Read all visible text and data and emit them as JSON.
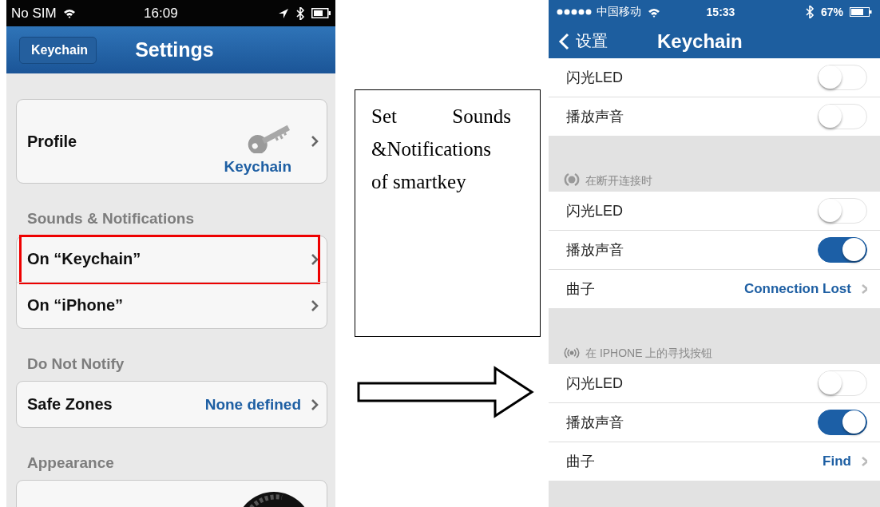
{
  "left_phone": {
    "status_bar": {
      "carrier": "No SIM",
      "time": "16:09"
    },
    "nav": {
      "back": "Keychain",
      "title": "Settings"
    },
    "sections": [
      {
        "rows": [
          {
            "kind": "profile",
            "label": "Profile",
            "value": "Keychain"
          }
        ]
      },
      {
        "header": "Sounds & Notifications",
        "rows": [
          {
            "kind": "link",
            "label": "On “Keychain”",
            "highlighted": true
          },
          {
            "kind": "link",
            "label": "On “iPhone”",
            "highlighted": false
          }
        ]
      },
      {
        "header": "Do Not Notify",
        "rows": [
          {
            "kind": "link",
            "label": "Safe Zones",
            "value": "None defined",
            "highlighted": false
          }
        ]
      },
      {
        "header": "Appearance",
        "rows": [
          {
            "kind": "dial"
          }
        ]
      }
    ]
  },
  "note": {
    "text": "Set Sounds &Notifications of smartkey"
  },
  "right_phone": {
    "status_bar": {
      "carrier": "中国移动",
      "time": "15:33",
      "battery": "67%"
    },
    "nav": {
      "back": "设置",
      "title": "Keychain"
    },
    "groups": [
      {
        "rows": [
          {
            "kind": "toggle",
            "label": "闪光LED",
            "on": false
          },
          {
            "kind": "toggle",
            "label": "播放声音",
            "on": false
          }
        ]
      },
      {
        "header": {
          "kind": "disconnect",
          "text": "在断开连接时"
        },
        "rows": [
          {
            "kind": "toggle",
            "label": "闪光LED",
            "on": false
          },
          {
            "kind": "toggle",
            "label": "播放声音",
            "on": true
          },
          {
            "kind": "link",
            "label": "曲子",
            "value": "Connection Lost"
          }
        ]
      },
      {
        "header": {
          "kind": "find",
          "text": "在 IPHONE 上的寻找按钮"
        },
        "rows": [
          {
            "kind": "toggle",
            "label": "闪光LED",
            "on": false
          },
          {
            "kind": "toggle",
            "label": "播放声音",
            "on": true
          },
          {
            "kind": "link",
            "label": "曲子",
            "value": "Find"
          }
        ]
      }
    ]
  }
}
